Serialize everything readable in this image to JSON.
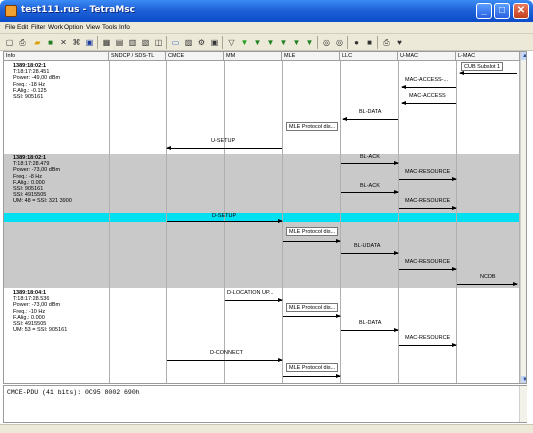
{
  "window": {
    "title": "test111.rus - TetraMsc",
    "minimize": "_",
    "maximize": "□",
    "close": "✕"
  },
  "menu": [
    "File",
    "Edit",
    "Filter",
    "Work",
    "Option",
    "View",
    "Tools",
    "Info"
  ],
  "toolbar_icons": [
    "new-icon",
    "print-icon",
    "open-icon",
    "save-icon",
    "cut-icon",
    "filter-icon",
    "export-icon",
    "grid-icon",
    "table-icon",
    "list-icon",
    "chart-icon",
    "window-icon",
    "bar-icon",
    "zoom-icon",
    "settings-icon",
    "funnel-icon",
    "funnel-green-icon",
    "funnel-x-icon",
    "funnel-x2-icon",
    "funnel-x3-icon",
    "funnel-x4-icon",
    "funnel-x5-icon",
    "circle-icon",
    "circle2-icon",
    "record-icon",
    "stop-icon",
    "printer-icon",
    "heart-icon"
  ],
  "columns": [
    "Info",
    "SNDCP / SDS-TL",
    "CMCE",
    "MM",
    "MLE",
    "LLC",
    "U-MAC",
    "L-MAC"
  ],
  "blocks": [
    {
      "header": "1389:18:02:1",
      "lines": [
        "T:18:17:28.451",
        "Power: -49,00 dBm",
        "Freq.: -18 Hz",
        "F.Alig.: -0.125",
        "SSI: 905161"
      ]
    },
    {
      "header": "1389:18:02:1",
      "lines": [
        "T:18:17:28.479",
        "Power: -73,00 dBm",
        "Freq.: -8 Hz",
        "F.Alig.: 0.000",
        "SSI: 905161",
        "SSI: 4915505",
        "UM: 48 = SSI: 321 3900"
      ]
    },
    {
      "header": "1389:18:04:1",
      "lines": [
        "T:18:17:28.536",
        "Power: -73,00 dBm",
        "Freq.: -10 Hz",
        "F.Alig.: 0.000",
        "SSI: 4915505",
        "UM: 53 = SSI: 905161"
      ]
    }
  ],
  "messages": {
    "cub": "CUB Subslot 1",
    "mac_access_trunc": "MAC-ACCESS-...",
    "mac_access": "MAC-ACCESS",
    "bl_data_1": "BL-DATA",
    "mle_proto_1": "MLE Protocol dis...",
    "u_setup": "U-SETUP",
    "bl_ack_1": "BL-ACK",
    "mac_resource_1": "MAC-RESOURCE",
    "bl_ack_2": "BL-ACK",
    "mac_resource_2": "MAC-RESOURCE",
    "d_setup": "D-SETUP",
    "mle_proto_2": "MLE Protocol dis...",
    "bl_udata": "BL-UDATA",
    "mac_resource_3": "MAC-RESOURCE",
    "ncdb": "NCDB",
    "d_location": "D-LOCATION UP...",
    "mle_proto_3": "MLE Protocol dis...",
    "bl_data_2": "BL-DATA",
    "mac_resource_4": "MAC-RESOURCE",
    "d_connect": "D-CONNECT",
    "mle_proto_4": "MLE Protocol dis..."
  },
  "hex_line": "CMCE-PDU (41 bits): 0C95 8002 690h",
  "colors": {
    "title_bar": "#1f62d8",
    "highlight": "#00e0f0",
    "band": "#c9c9c9"
  }
}
